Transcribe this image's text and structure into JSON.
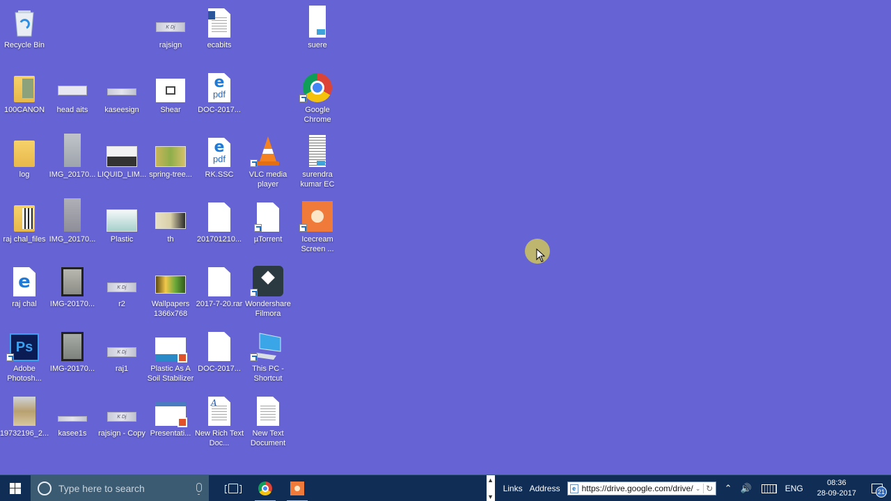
{
  "desktop": {
    "background_color": "#6664d4",
    "icons": [
      {
        "id": "recycle-bin",
        "label": "Recycle Bin",
        "kind": "recycle-bin"
      },
      {
        "id": "rajsign",
        "label": "rajsign",
        "kind": "signature-image"
      },
      {
        "id": "ecabits",
        "label": "ecabits",
        "kind": "word-document"
      },
      {
        "id": "suere",
        "label": "suere",
        "kind": "document-thumbnail"
      },
      {
        "id": "100canon",
        "label": "100CANON",
        "kind": "folder-with-images"
      },
      {
        "id": "head-aits",
        "label": "head aits",
        "kind": "image"
      },
      {
        "id": "kaseesign",
        "label": "kaseesign",
        "kind": "signature-image"
      },
      {
        "id": "shear",
        "label": "Shear",
        "kind": "image"
      },
      {
        "id": "doc-2017-a",
        "label": "DOC-2017...",
        "kind": "edge-pdf"
      },
      {
        "id": "google-chrome",
        "label": "Google Chrome",
        "kind": "chrome-shortcut"
      },
      {
        "id": "log",
        "label": "log",
        "kind": "folder"
      },
      {
        "id": "img-20170-a",
        "label": "IMG_20170...",
        "kind": "photo"
      },
      {
        "id": "liquid-lim",
        "label": "LIQUID_LIM...",
        "kind": "photo"
      },
      {
        "id": "spring-tree",
        "label": "spring-tree...",
        "kind": "photo"
      },
      {
        "id": "rk-ssc",
        "label": "RK.SSC",
        "kind": "edge-pdf"
      },
      {
        "id": "vlc",
        "label": "VLC media player",
        "kind": "vlc-shortcut"
      },
      {
        "id": "surendra",
        "label": "surendra kumar EC",
        "kind": "document-thumbnail"
      },
      {
        "id": "raj-chal-files",
        "label": "raj chal_files",
        "kind": "folder-with-images"
      },
      {
        "id": "img-20170-b",
        "label": "IMG_20170...",
        "kind": "photo"
      },
      {
        "id": "plastic",
        "label": "Plastic",
        "kind": "photo"
      },
      {
        "id": "th",
        "label": "th",
        "kind": "photo"
      },
      {
        "id": "201701210",
        "label": "201701210...",
        "kind": "blank-file"
      },
      {
        "id": "utorrent",
        "label": "µTorrent",
        "kind": "blank-file-shortcut"
      },
      {
        "id": "icecream",
        "label": "Icecream Screen ...",
        "kind": "icecream-shortcut"
      },
      {
        "id": "raj-chal",
        "label": "raj chal",
        "kind": "edge-html"
      },
      {
        "id": "img-20170-c",
        "label": "IMG-20170...",
        "kind": "photo"
      },
      {
        "id": "r2",
        "label": "r2",
        "kind": "signature-image"
      },
      {
        "id": "wallpapers",
        "label": "Wallpapers 1366x768",
        "kind": "photo"
      },
      {
        "id": "rar-2017",
        "label": "2017-7-20.rar",
        "kind": "blank-file"
      },
      {
        "id": "filmora",
        "label": "Wondershare Filmora",
        "kind": "filmora-shortcut"
      },
      {
        "id": "photoshop",
        "label": "Adobe Photosh...",
        "kind": "photoshop-shortcut"
      },
      {
        "id": "img-20170-d",
        "label": "IMG-20170...",
        "kind": "photo"
      },
      {
        "id": "raj1",
        "label": "raj1",
        "kind": "signature-image"
      },
      {
        "id": "plastic-soil",
        "label": "Plastic As A Soil Stabilizer",
        "kind": "powerpoint"
      },
      {
        "id": "doc-2017-b",
        "label": "DOC-2017...",
        "kind": "blank-file"
      },
      {
        "id": "this-pc",
        "label": "This PC - Shortcut",
        "kind": "pc-shortcut"
      },
      {
        "id": "19732196",
        "label": "19732196_2...",
        "kind": "photo"
      },
      {
        "id": "kasee1s",
        "label": "kasee1s",
        "kind": "signature-image"
      },
      {
        "id": "rajsign-copy",
        "label": "rajsign - Copy",
        "kind": "signature-image"
      },
      {
        "id": "presentati",
        "label": "Presentati...",
        "kind": "powerpoint"
      },
      {
        "id": "new-rich-text",
        "label": "New Rich Text Doc...",
        "kind": "rich-text"
      },
      {
        "id": "new-text",
        "label": "New Text Document",
        "kind": "text-document"
      }
    ]
  },
  "taskbar": {
    "search_placeholder": "Type here to search",
    "pinned": [
      {
        "name": "Google Chrome",
        "icon": "chrome-icon",
        "active": true
      },
      {
        "name": "Icecream Screen Recorder",
        "icon": "icecream-icon",
        "active": true
      }
    ],
    "links_label": "Links",
    "address_label": "Address",
    "address_value": "https://drive.google.com/drive/",
    "language": "ENG",
    "time": "08:36",
    "date": "28-09-2017",
    "notification_count": "21"
  }
}
